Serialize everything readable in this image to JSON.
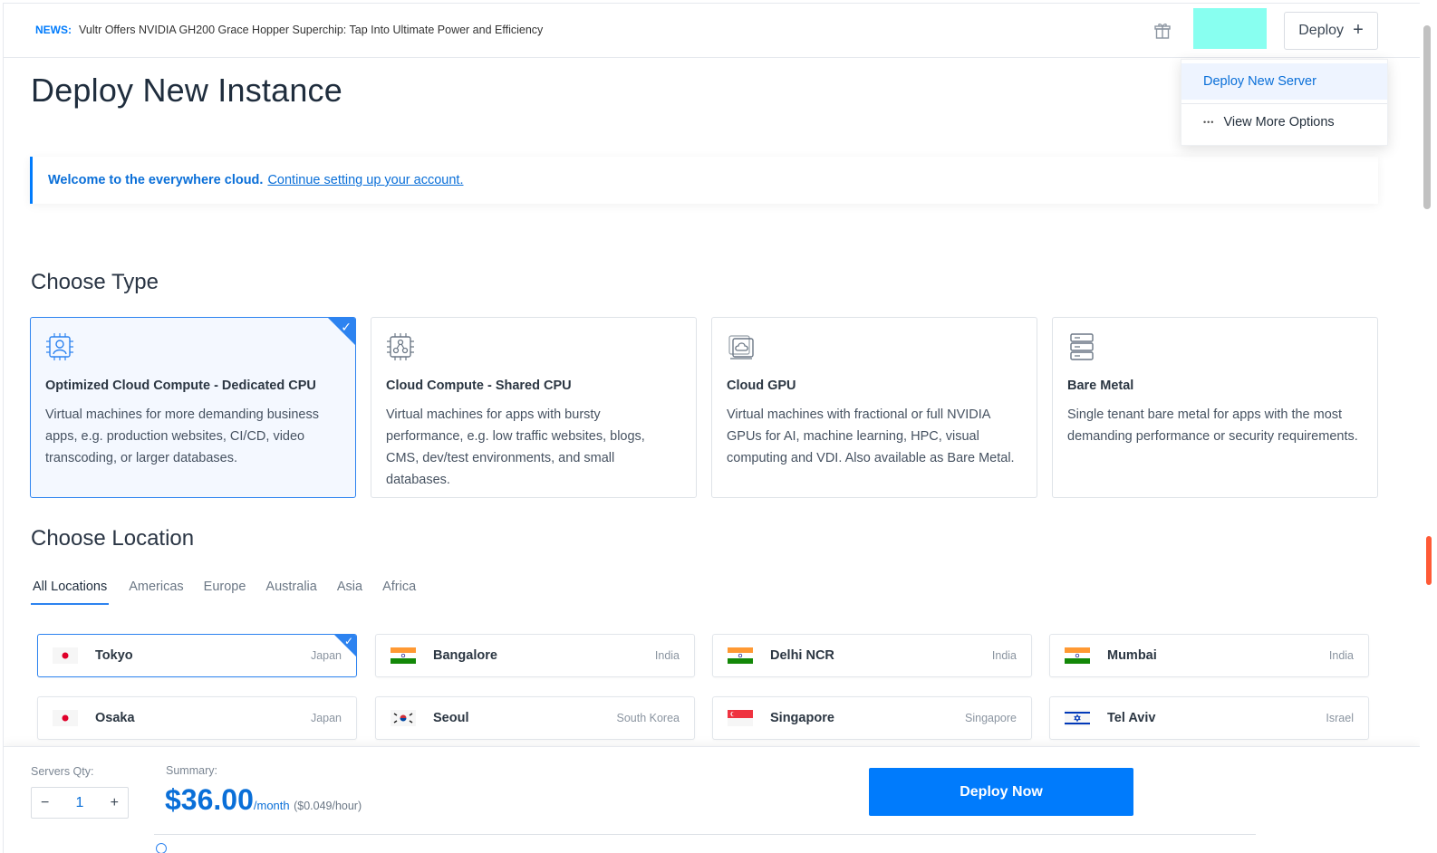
{
  "news": {
    "tag": "NEWS:",
    "text": "Vultr Offers NVIDIA GH200 Grace Hopper Superchip: Tap Into Ultimate Power and Efficiency"
  },
  "header": {
    "deploy_label": "Deploy",
    "deploy_icon": "+"
  },
  "dropdown": {
    "items": [
      {
        "label": "Deploy New Server"
      },
      {
        "label": "View More Options",
        "icon": "..."
      }
    ]
  },
  "page": {
    "title": "Deploy New Instance"
  },
  "banner": {
    "bold": "Welcome to the everywhere cloud.",
    "link": "Continue setting up your account."
  },
  "choose_type": {
    "heading": "Choose Type",
    "cards": [
      {
        "title": "Optimized Cloud Compute - Dedicated CPU",
        "desc": "Virtual machines for more demanding business apps, e.g. production websites, CI/CD, video transcoding, or larger databases.",
        "selected": true
      },
      {
        "title": "Cloud Compute - Shared CPU",
        "desc": "Virtual machines for apps with bursty performance, e.g. low traffic websites, blogs, CMS, dev/test environments, and small databases.",
        "selected": false
      },
      {
        "title": "Cloud GPU",
        "desc": "Virtual machines with fractional or full NVIDIA GPUs for AI, machine learning, HPC, visual computing and VDI. Also available as Bare Metal.",
        "selected": false
      },
      {
        "title": "Bare Metal",
        "desc": "Single tenant bare metal for apps with the most demanding performance or security requirements.",
        "selected": false
      }
    ]
  },
  "choose_location": {
    "heading": "Choose Location",
    "tabs": [
      "All Locations",
      "Americas",
      "Europe",
      "Australia",
      "Asia",
      "Africa"
    ],
    "locations": [
      {
        "city": "Tokyo",
        "country": "Japan",
        "flag": "japan"
      },
      {
        "city": "Bangalore",
        "country": "India",
        "flag": "india"
      },
      {
        "city": "Delhi NCR",
        "country": "India",
        "flag": "india"
      },
      {
        "city": "Mumbai",
        "country": "India",
        "flag": "india"
      },
      {
        "city": "Osaka",
        "country": "Japan",
        "flag": "japan"
      },
      {
        "city": "Seoul",
        "country": "South Korea",
        "flag": "south-korea"
      },
      {
        "city": "Singapore",
        "country": "Singapore",
        "flag": "singapore"
      },
      {
        "city": "Tel Aviv",
        "country": "Israel",
        "flag": "israel"
      }
    ]
  },
  "summary": {
    "qty_label": "Servers Qty:",
    "qty_value": "1",
    "minus": "−",
    "plus": "+",
    "summary_label": "Summary:",
    "price": "$36.00",
    "per": "/month",
    "hourly": "($0.049/hour)",
    "deploy_now": "Deploy Now"
  },
  "colors": {
    "accent": "#007bfc",
    "avatar": "#88fff0",
    "scroll_marker": "#ff5a36"
  }
}
